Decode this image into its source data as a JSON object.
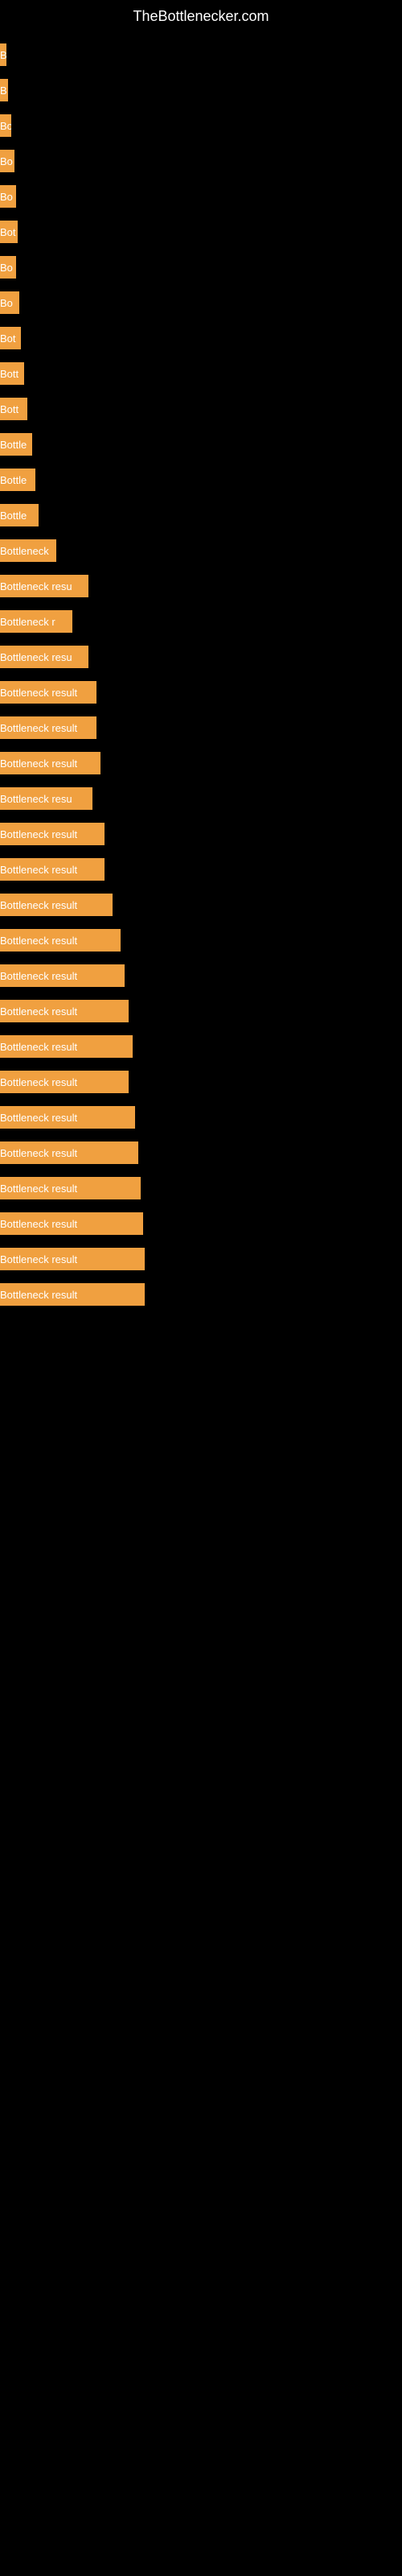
{
  "site": {
    "title": "TheBottlenecker.com"
  },
  "bars": [
    {
      "label": "B",
      "width": 8
    },
    {
      "label": "B",
      "width": 10
    },
    {
      "label": "Bo",
      "width": 14
    },
    {
      "label": "Bo",
      "width": 18
    },
    {
      "label": "Bo",
      "width": 20
    },
    {
      "label": "Bot",
      "width": 22
    },
    {
      "label": "Bo",
      "width": 20
    },
    {
      "label": "Bo",
      "width": 24
    },
    {
      "label": "Bot",
      "width": 26
    },
    {
      "label": "Bott",
      "width": 30
    },
    {
      "label": "Bott",
      "width": 34
    },
    {
      "label": "Bottle",
      "width": 40
    },
    {
      "label": "Bottle",
      "width": 44
    },
    {
      "label": "Bottle",
      "width": 48
    },
    {
      "label": "Bottleneck",
      "width": 70
    },
    {
      "label": "Bottleneck resu",
      "width": 110
    },
    {
      "label": "Bottleneck r",
      "width": 90
    },
    {
      "label": "Bottleneck resu",
      "width": 110
    },
    {
      "label": "Bottleneck result",
      "width": 120
    },
    {
      "label": "Bottleneck result",
      "width": 120
    },
    {
      "label": "Bottleneck result",
      "width": 125
    },
    {
      "label": "Bottleneck resu",
      "width": 115
    },
    {
      "label": "Bottleneck result",
      "width": 130
    },
    {
      "label": "Bottleneck result",
      "width": 130
    },
    {
      "label": "Bottleneck result",
      "width": 140
    },
    {
      "label": "Bottleneck result",
      "width": 150
    },
    {
      "label": "Bottleneck result",
      "width": 155
    },
    {
      "label": "Bottleneck result",
      "width": 160
    },
    {
      "label": "Bottleneck result",
      "width": 165
    },
    {
      "label": "Bottleneck result",
      "width": 160
    },
    {
      "label": "Bottleneck result",
      "width": 168
    },
    {
      "label": "Bottleneck result",
      "width": 172
    },
    {
      "label": "Bottleneck result",
      "width": 175
    },
    {
      "label": "Bottleneck result",
      "width": 178
    },
    {
      "label": "Bottleneck result",
      "width": 180
    },
    {
      "label": "Bottleneck result",
      "width": 180
    }
  ]
}
